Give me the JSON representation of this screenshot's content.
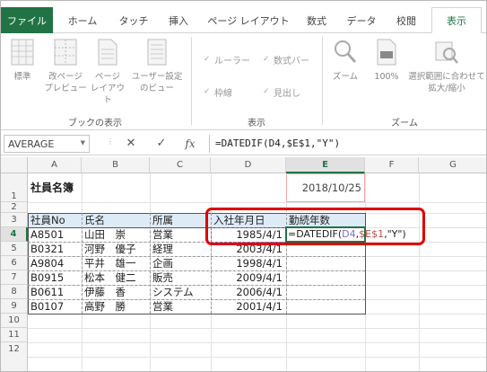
{
  "ribbon": {
    "tabs": [
      "ファイル",
      "ホーム",
      "タッチ",
      "挿入",
      "ページ レイアウト",
      "数式",
      "データ",
      "校閲",
      "表示"
    ],
    "groups": {
      "book_views": {
        "label": "ブックの表示",
        "buttons": [
          "標準",
          "改ページ\nプレビュー",
          "ページ\nレイアウト",
          "ユーザー設定\nのビュー"
        ]
      },
      "show": {
        "label": "表示",
        "checkboxes": [
          "ルーラー",
          "数式バー",
          "枠線",
          "見出し"
        ]
      },
      "zoom": {
        "label": "ズーム",
        "buttons": [
          "ズーム",
          "100%",
          "選択範囲に合わせて\n拡大/縮小"
        ]
      }
    }
  },
  "formula_bar": {
    "name_box": "AVERAGE",
    "fx": "fx",
    "formula": "=DATEDIF(D4,$E$1,\"Y\")"
  },
  "sheet": {
    "columns": [
      "A",
      "B",
      "C",
      "D",
      "E",
      "F",
      "G"
    ],
    "rows": [
      "1",
      "2",
      "3",
      "4",
      "5",
      "6",
      "7",
      "8",
      "9",
      "10",
      "11",
      "12"
    ],
    "title": "社員名簿",
    "base_date": "2018/10/25",
    "headers": [
      "社員No",
      "氏名",
      "所属",
      "入社年月日",
      "勤続年数"
    ],
    "records": [
      {
        "no": "A8501",
        "name": "山田　崇",
        "dept": "営業",
        "date": "1985/4/1"
      },
      {
        "no": "B0321",
        "name": "河野　優子",
        "dept": "経理",
        "date": "2003/4/1"
      },
      {
        "no": "A9804",
        "name": "平井　雄一",
        "dept": "企画",
        "date": "1998/4/1"
      },
      {
        "no": "B0915",
        "name": "松本　健二",
        "dept": "販売",
        "date": "2009/4/1"
      },
      {
        "no": "B0611",
        "name": "伊藤　香",
        "dept": "システム",
        "date": "2006/4/1"
      },
      {
        "no": "B0107",
        "name": "高野　勝",
        "dept": "営業",
        "date": "2001/4/1"
      }
    ],
    "editing_cell": {
      "prefix": "=DATEDIF(",
      "ref1": "D4",
      "sep": ",",
      "ref2": "$E$1",
      "suffix": ",\"Y\")"
    }
  }
}
